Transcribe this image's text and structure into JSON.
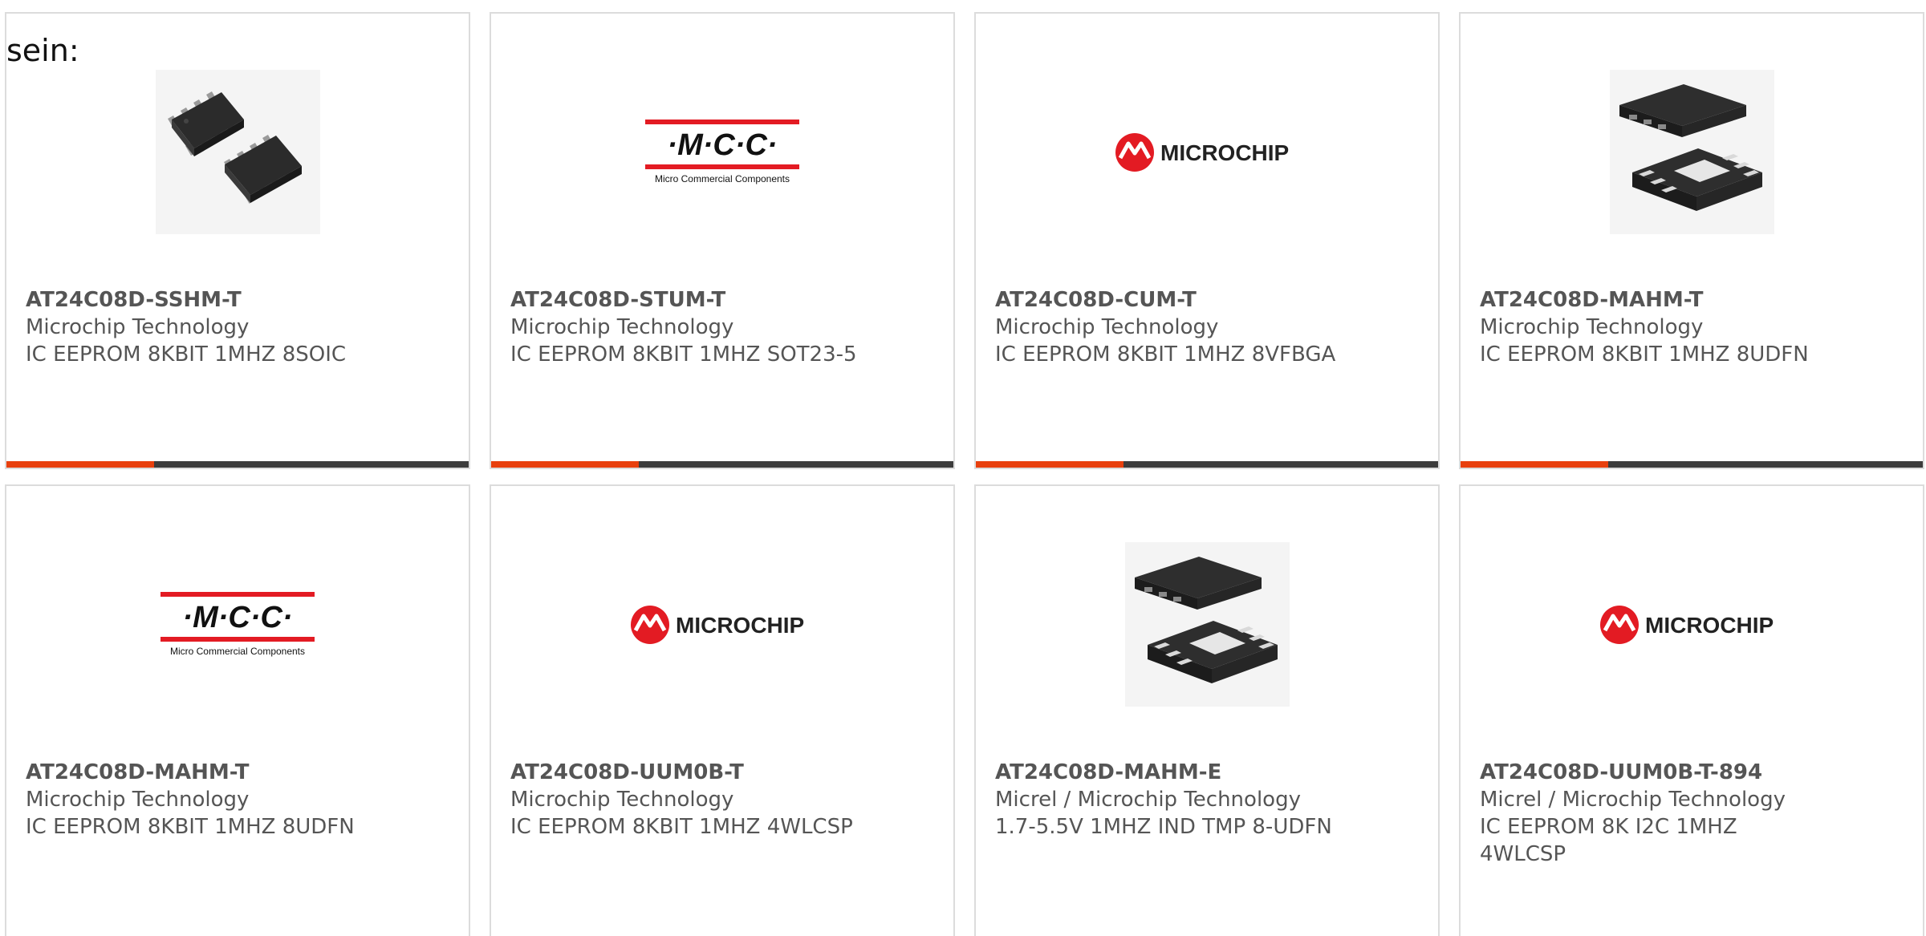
{
  "intro_text": "sein:",
  "colors": {
    "accent": "#e8400e",
    "bar_dark": "#3c3c3c",
    "border": "#dcdcdc",
    "text": "#555555",
    "brand_red": "#e31b23"
  },
  "products": [
    {
      "part_number": "AT24C08D-SSHM-T",
      "manufacturer": "Microchip Technology",
      "description": "IC EEPROM 8KBIT 1MHZ 8SOIC",
      "image": "soic-8-chip-image"
    },
    {
      "part_number": "AT24C08D-STUM-T",
      "manufacturer": "Microchip Technology",
      "description": "IC EEPROM 8KBIT 1MHZ SOT23-5",
      "image": "mcc-logo",
      "logo_text": "·M·C·C·",
      "logo_tagline": "Micro Commercial Components"
    },
    {
      "part_number": "AT24C08D-CUM-T",
      "manufacturer": "Microchip Technology",
      "description": "IC EEPROM 8KBIT 1MHZ 8VFBGA",
      "image": "microchip-logo",
      "logo_text": "MICROCHIP"
    },
    {
      "part_number": "AT24C08D-MAHM-T",
      "manufacturer": "Microchip Technology",
      "description": "IC EEPROM 8KBIT 1MHZ 8UDFN",
      "image": "udfn-8-chip-image"
    },
    {
      "part_number": "AT24C08D-MAHM-T",
      "manufacturer": "Microchip Technology",
      "description": "IC EEPROM 8KBIT 1MHZ 8UDFN",
      "image": "mcc-logo",
      "logo_text": "·M·C·C·",
      "logo_tagline": "Micro Commercial Components"
    },
    {
      "part_number": "AT24C08D-UUM0B-T",
      "manufacturer": "Microchip Technology",
      "description": "IC EEPROM 8KBIT 1MHZ 4WLCSP",
      "image": "microchip-logo",
      "logo_text": "MICROCHIP"
    },
    {
      "part_number": "AT24C08D-MAHM-E",
      "manufacturer": "Micrel / Microchip Technology",
      "description": "1.7-5.5V 1MHZ IND TMP 8-UDFN",
      "image": "udfn-8-chip-image"
    },
    {
      "part_number": "AT24C08D-UUM0B-T-894",
      "manufacturer": "Micrel / Microchip Technology",
      "description": "IC EEPROM 8K I2C 1MHZ 4WLCSP",
      "image": "microchip-logo",
      "logo_text": "MICROCHIP"
    }
  ]
}
